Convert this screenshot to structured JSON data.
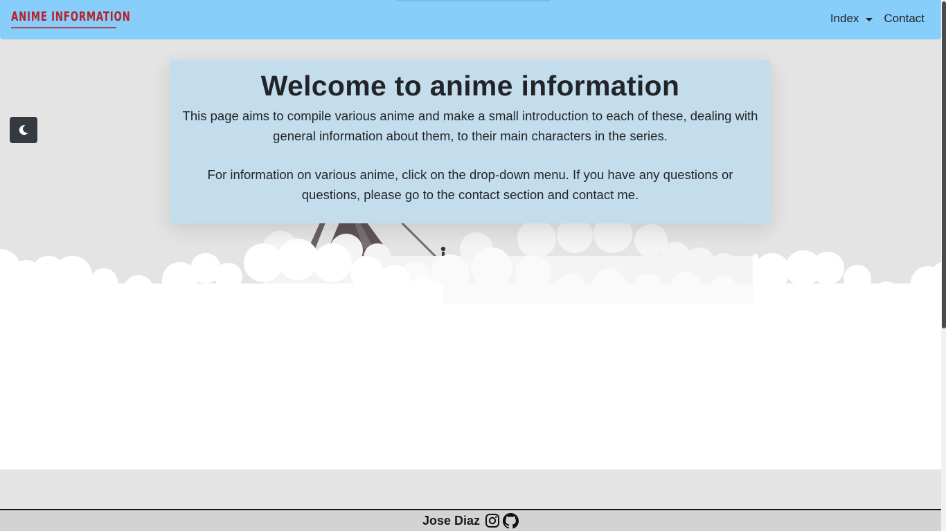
{
  "navbar": {
    "brand": "ANIME INFORMATION",
    "links": [
      {
        "label": "Index",
        "has_dropdown": true
      },
      {
        "label": "Contact",
        "has_dropdown": false
      }
    ],
    "background": "#87cefa"
  },
  "theme_toggle": {
    "icon": "moon-icon"
  },
  "welcome": {
    "title": "Welcome to anime information",
    "paragraph1": "This page aims to compile various anime and make a small introduction to each of these, dealing with general information about them, to their main characters in the series.",
    "paragraph2": "For information on various anime, click on the drop-down menu. If you have any questions or questions, please go to the contact section and contact me.",
    "background": "#c4ddec"
  },
  "footer": {
    "name": "Jose Diaz",
    "icons": [
      "instagram-icon",
      "github-icon"
    ]
  }
}
